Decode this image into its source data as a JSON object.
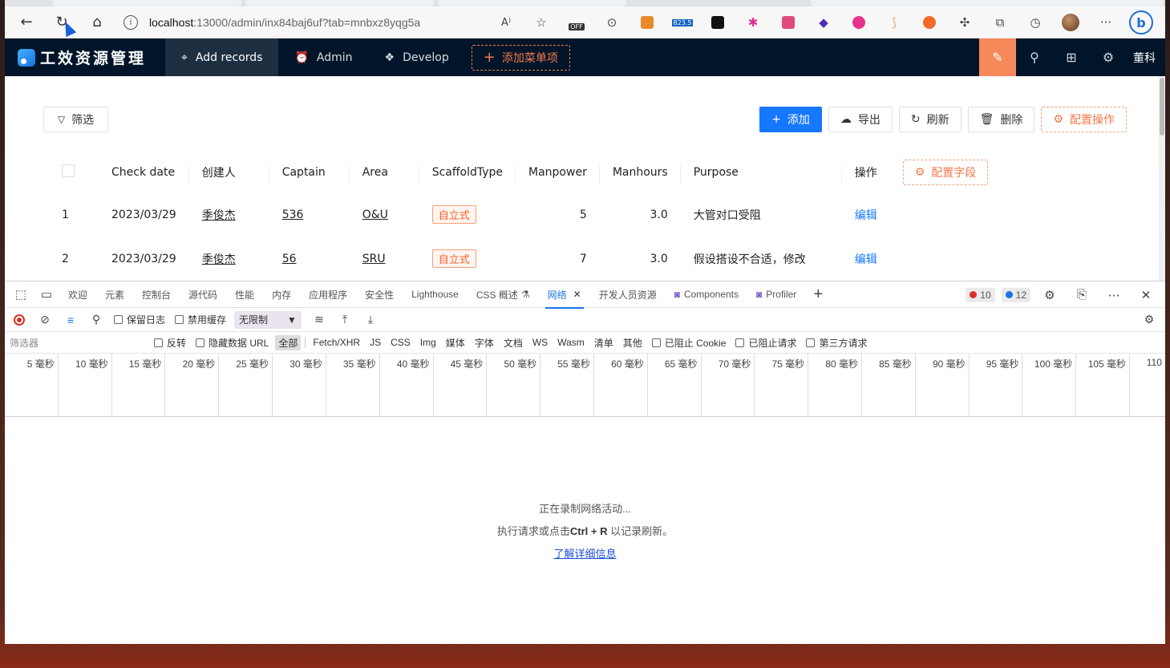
{
  "browser": {
    "url_host": "localhost",
    "url_path": ":13000/admin/inx84baj6uf?tab=mnbxz8yqg5a",
    "ext_badge_off": "OFF",
    "ext_badge_num": "823.5"
  },
  "app": {
    "logo_text": "工效资源管理",
    "menu": [
      {
        "label": "Add records",
        "icon": "target-icon"
      },
      {
        "label": "Admin",
        "icon": "alarm-icon"
      },
      {
        "label": "Develop",
        "icon": "dropbox-icon"
      }
    ],
    "add_menu_label": "添加菜单项",
    "user": "董科"
  },
  "toolbar": {
    "filter": "筛选",
    "add": "添加",
    "export": "导出",
    "refresh": "刷新",
    "delete": "删除",
    "config_actions": "配置操作"
  },
  "table": {
    "headers": [
      "Check date",
      "创建人",
      "Captain",
      "Area",
      "ScaffoldType",
      "Manpower",
      "Manhours",
      "Purpose",
      "操作"
    ],
    "config_fields": "配置字段",
    "rows": [
      {
        "index": "1",
        "date": "2023/03/29",
        "creator": "季俊杰",
        "captain": "536",
        "area": "O&U",
        "type": "自立式",
        "manpower": "5",
        "manhours": "3.0",
        "purpose": "大管对口受阻",
        "action": "编辑"
      },
      {
        "index": "2",
        "date": "2023/03/29",
        "creator": "季俊杰",
        "captain": "56",
        "area": "SRU",
        "type": "自立式",
        "manpower": "7",
        "manhours": "3.0",
        "purpose": "假设搭设不合适，修改",
        "action": "编辑"
      }
    ]
  },
  "devtools": {
    "tabs": [
      "欢迎",
      "元素",
      "控制台",
      "源代码",
      "性能",
      "内存",
      "应用程序",
      "安全性",
      "Lighthouse",
      "CSS 概述",
      "网络",
      "开发人员资源",
      "Components",
      "Profiler"
    ],
    "error_count": "10",
    "info_count": "12",
    "preserve_log": "保留日志",
    "disable_cache": "禁用缓存",
    "throttle": "无限制",
    "filter_placeholder": "筛选器",
    "invert": "反转",
    "hide_data_url": "隐藏数据 URL",
    "types": [
      "全部",
      "Fetch/XHR",
      "JS",
      "CSS",
      "Img",
      "媒体",
      "字体",
      "文档",
      "WS",
      "Wasm",
      "清单",
      "其他"
    ],
    "blocked_cookies": "已阻止 Cookie",
    "blocked_requests": "已阻止请求",
    "third_party": "第三方请求",
    "timeline": [
      "5 毫秒",
      "10 毫秒",
      "15 毫秒",
      "20 毫秒",
      "25 毫秒",
      "30 毫秒",
      "35 毫秒",
      "40 毫秒",
      "45 毫秒",
      "50 毫秒",
      "55 毫秒",
      "60 毫秒",
      "65 毫秒",
      "70 毫秒",
      "75 毫秒",
      "80 毫秒",
      "85 毫秒",
      "90 毫秒",
      "95 毫秒",
      "100 毫秒",
      "105 毫秒",
      "110"
    ],
    "empty_line1": "正在录制网络活动...",
    "empty_line2_pre": "执行请求或点击",
    "empty_line2_key": "Ctrl + R",
    "empty_line2_post": " 以记录刷新。",
    "learn_more": "了解详细信息"
  }
}
